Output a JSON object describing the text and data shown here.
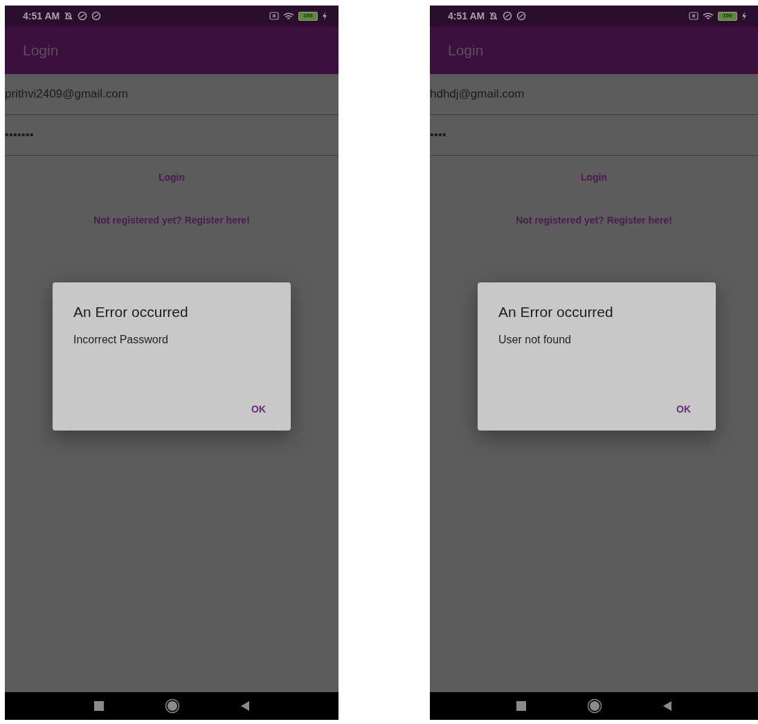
{
  "phones": [
    {
      "status_bar": {
        "time": "4:51 AM",
        "battery": "100"
      },
      "app_bar": {
        "title": "Login"
      },
      "email_field": {
        "value": "prithvi2409@gmail.com"
      },
      "password_field": {
        "value": "•••••••"
      },
      "login_button": "Login",
      "register_link": "Not registered yet? Register here!",
      "dialog": {
        "title": "An Error occurred",
        "message": "Incorrect Password",
        "button": "OK"
      }
    },
    {
      "status_bar": {
        "time": "4:51 AM",
        "battery": "100"
      },
      "app_bar": {
        "title": "Login"
      },
      "email_field": {
        "value": "hdhdj@gmail.com"
      },
      "password_field": {
        "value": "••••"
      },
      "login_button": "Login",
      "register_link": "Not registered yet? Register here!",
      "dialog": {
        "title": "An Error occurred",
        "message": "User not found",
        "button": "OK"
      }
    }
  ]
}
